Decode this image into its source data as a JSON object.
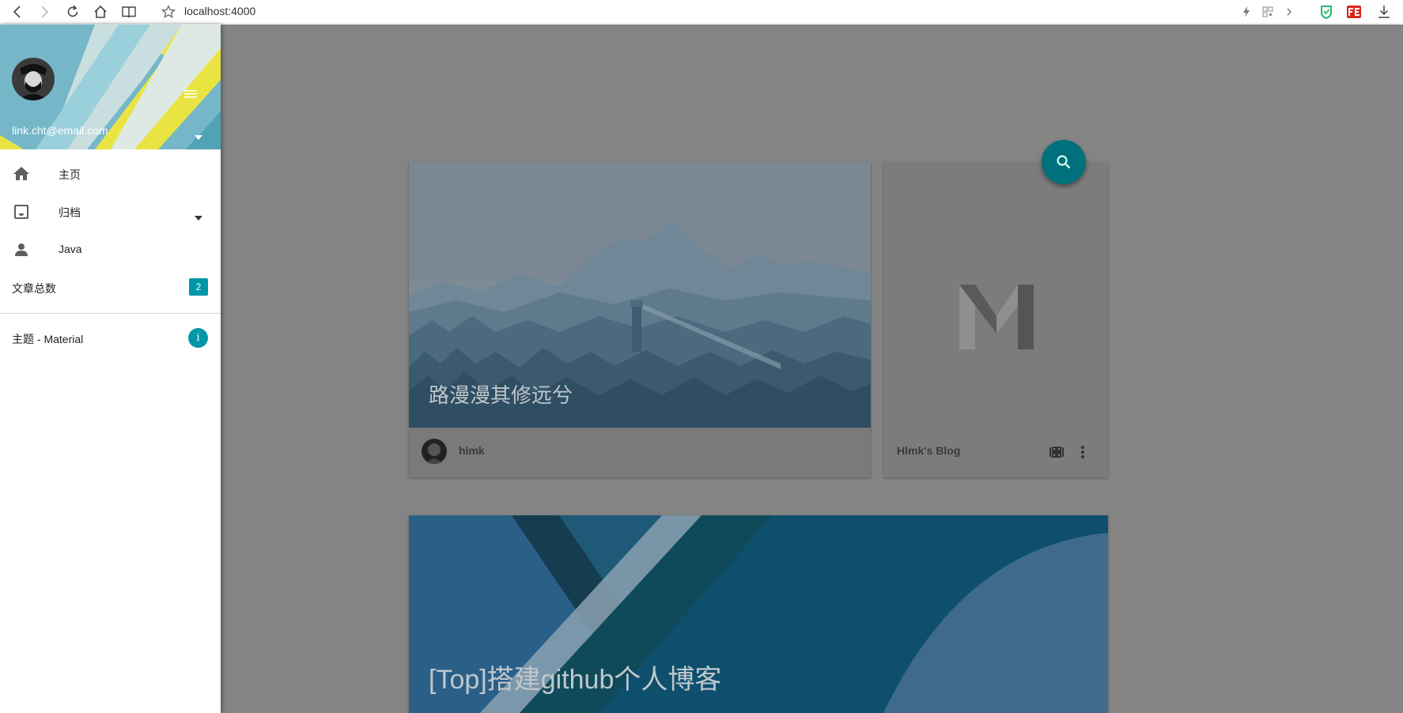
{
  "browser": {
    "url": "localhost:4000"
  },
  "drawer": {
    "email": "link.cht@email.com",
    "items": [
      {
        "label": "主页",
        "icon": "home-icon"
      },
      {
        "label": "归档",
        "icon": "inbox-icon"
      },
      {
        "label": "Java",
        "icon": "person-icon"
      }
    ],
    "post_count_label": "文章总数",
    "post_count": "2",
    "theme_label": "主题 - Material",
    "theme_badge": "i"
  },
  "cards": [
    {
      "title": "路漫漫其修远兮",
      "author": "hlmk"
    },
    {
      "blog_name": "Hlmk's Blog"
    },
    {
      "title": "[Top]搭建github个人博客"
    }
  ],
  "colors": {
    "accent": "#0097a7",
    "fab": "#00707c",
    "overlay": "#848484"
  }
}
